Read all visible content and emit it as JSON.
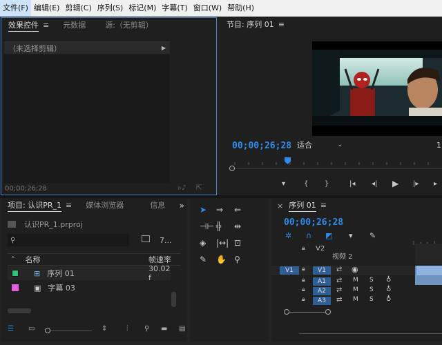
{
  "menu": [
    "文件(F)",
    "编辑(E)",
    "剪辑(C)",
    "序列(S)",
    "标记(M)",
    "字幕(T)",
    "窗口(W)",
    "帮助(H)"
  ],
  "effects_panel": {
    "tabs": [
      "效果控件",
      "元数据",
      "源:（无剪辑）"
    ],
    "clip_placeholder": "（未选择剪辑）",
    "timecode": "00;00;26;28"
  },
  "program_monitor": {
    "title": "节目: 序列 01",
    "timecode": "00;00;26;28",
    "fit_select": "适合",
    "right_edge_label": "1",
    "playhead_fraction": 0.28
  },
  "project_panel": {
    "tabs": [
      "项目: 认识PR_1",
      "媒体浏览器",
      "信息"
    ],
    "project_file": "认识PR_1.prproj",
    "item_count": "7...",
    "columns": {
      "name": "名称",
      "framerate": "帧速率"
    },
    "items": [
      {
        "name": "序列 01",
        "framerate": "30.02 f",
        "color": "#2ec27e"
      },
      {
        "name": "字幕 03",
        "framerate": "",
        "color": "#e35ee0"
      }
    ]
  },
  "timeline": {
    "title": "序列 01",
    "timecode": "00;00;26;28",
    "video_tracks": [
      {
        "label": "V2",
        "name": "视频 2"
      },
      {
        "label": "V1",
        "source": "V1"
      }
    ],
    "audio_tracks": [
      {
        "label": "A1",
        "m": "M",
        "s": "S"
      },
      {
        "label": "A2",
        "m": "M",
        "s": "S"
      },
      {
        "label": "A3",
        "m": "M",
        "s": "S"
      }
    ]
  },
  "icons": {
    "menu_hamburger": "≡",
    "expand": "»",
    "close": "×",
    "chevron_right": "▶",
    "chevron_down": "⌄"
  },
  "colors": {
    "accent_blue": "#2d8ceb",
    "panel_bg": "#1f1f1f",
    "app_bg": "#232323",
    "focus_border": "#4a82c6"
  }
}
